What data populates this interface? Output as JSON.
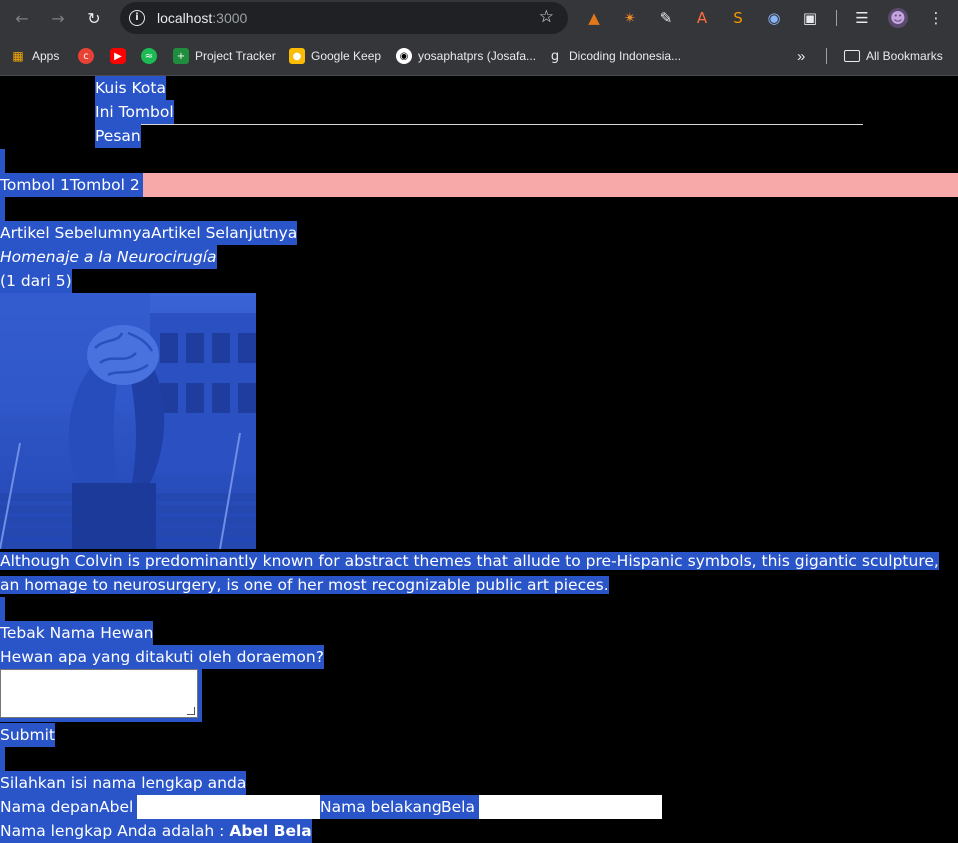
{
  "browser": {
    "url_host": "localhost",
    "url_port": ":3000",
    "bookmarks": [
      {
        "label": "Apps",
        "color": "#1a73e8"
      },
      {
        "label": "",
        "color": "#e94235"
      },
      {
        "label": "",
        "color": "#ff0000"
      },
      {
        "label": "",
        "color": "#1db954"
      },
      {
        "label": "Project Tracker",
        "color": "#1e8e3e"
      },
      {
        "label": "Google Keep",
        "color": "#fbbc04"
      },
      {
        "label": "yosaphatprs (Josafa...",
        "color": "#ffffff"
      },
      {
        "label": "Dicoding Indonesia...",
        "color": "#9aa0a6"
      }
    ],
    "more_bookmarks": "»",
    "all_bookmarks": "All Bookmarks"
  },
  "nav": {
    "items": [
      "Kuis Kota",
      "Ini Tombol",
      "Pesan"
    ]
  },
  "buttons": {
    "tombol1": "Tombol 1",
    "tombol2": "Tombol 2"
  },
  "article": {
    "prev": "Artikel Sebelumnya",
    "next": "Artikel Selanjutnya",
    "title": "Homenaje a la Neurocirugía",
    "counter": "(1 dari 5)",
    "description": "Although Colvin is predominantly known for abstract themes that allude to pre-Hispanic symbols, this gigantic sculpture, an homage to neurosurgery, is one of her most recognizable public art pieces."
  },
  "quiz": {
    "heading": "Tebak Nama Hewan",
    "question": "Hewan apa yang ditakuti oleh doraemon?",
    "answer": "",
    "submit": "Submit"
  },
  "name_form": {
    "prompt": "Silahkan isi nama lengkap anda",
    "first_label": "Nama depan:",
    "first_value": "Abel",
    "last_label": "Nama belakang:",
    "last_value": "Bela",
    "full_label": "Nama lengkap Anda adalah : ",
    "full_value": "Abel Bela"
  },
  "colors": {
    "selection": "#2a55c9",
    "pink_bar": "#f7a8a8",
    "chrome": "#35363a"
  }
}
